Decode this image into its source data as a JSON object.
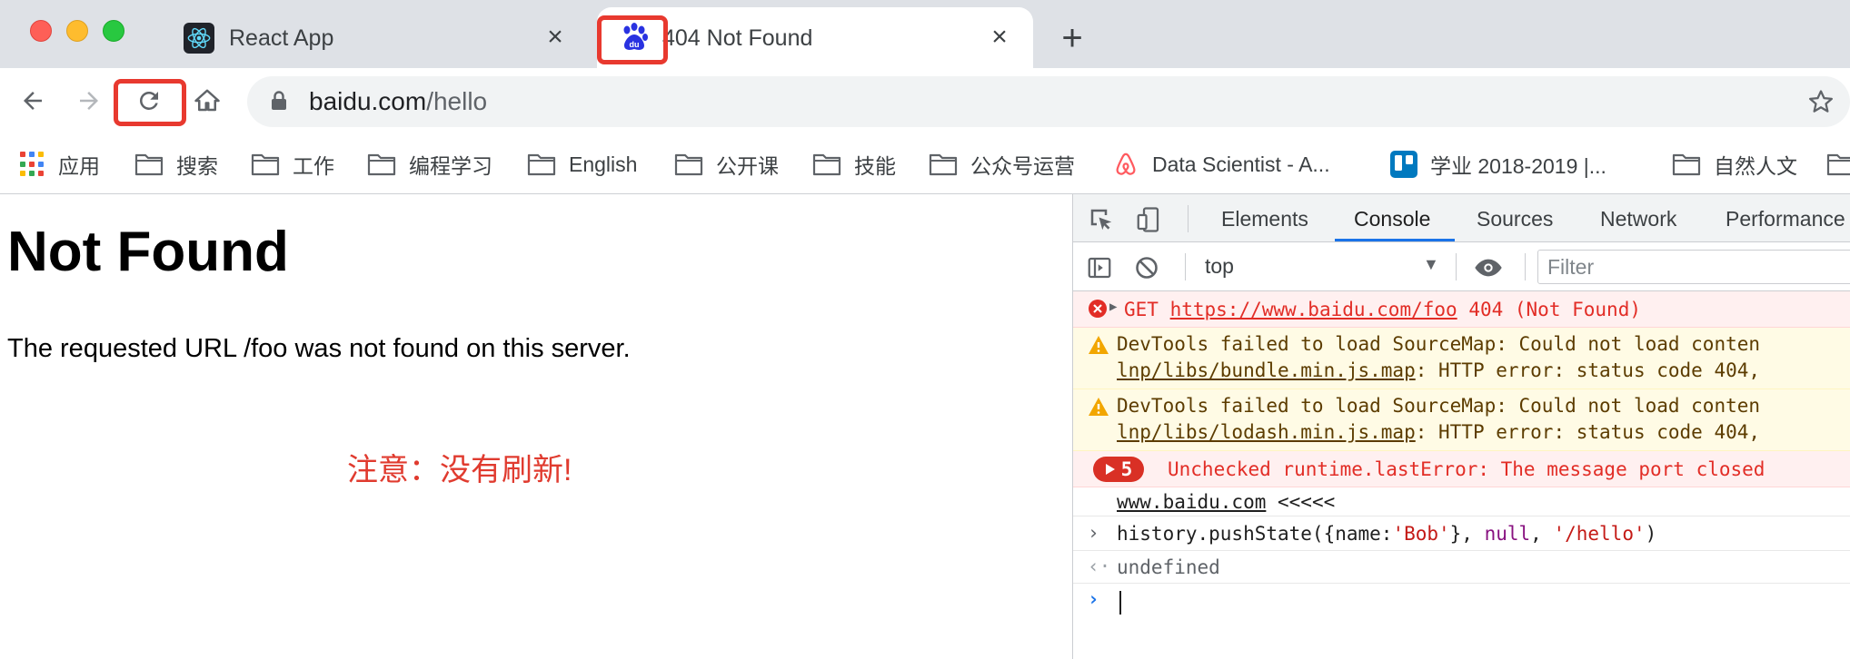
{
  "browser": {
    "tabs": [
      {
        "title": "React App",
        "favicon": "react-icon",
        "active": false
      },
      {
        "title": "404 Not Found",
        "favicon": "baidu-paw-icon",
        "active": true
      }
    ],
    "toolbar": {
      "url_host": "baidu.com",
      "url_path": "/hello"
    },
    "bookmarks": [
      {
        "label": "应用",
        "icon": "apps-grid-icon"
      },
      {
        "label": "搜索",
        "icon": "folder-icon"
      },
      {
        "label": "工作",
        "icon": "folder-icon"
      },
      {
        "label": "编程学习",
        "icon": "folder-icon"
      },
      {
        "label": "English",
        "icon": "folder-icon"
      },
      {
        "label": "公开课",
        "icon": "folder-icon"
      },
      {
        "label": "技能",
        "icon": "folder-icon"
      },
      {
        "label": "公众号运营",
        "icon": "folder-icon"
      },
      {
        "label": "Data Scientist - A...",
        "icon": "airbnb-icon"
      },
      {
        "label": "学业 2018-2019 |...",
        "icon": "trello-icon"
      },
      {
        "label": "自然人文",
        "icon": "folder-icon"
      }
    ],
    "colors": {
      "annotation_red": "#e8392f",
      "tab_strip": "#dee1e6"
    }
  },
  "page": {
    "heading": "Not Found",
    "message": "The requested URL /foo was not found on this server.",
    "annotation": "注意：没有刷新!"
  },
  "devtools": {
    "tabs": [
      "Elements",
      "Console",
      "Sources",
      "Network",
      "Performance"
    ],
    "active_tab": "Console",
    "context": "top",
    "filter_placeholder": "Filter",
    "messages": {
      "error_get": {
        "method": "GET",
        "url": "https://www.baidu.com/foo",
        "status": "404 (Not Found)"
      },
      "warn1": {
        "line1": "DevTools failed to load SourceMap: Could not load conten",
        "link": "lnp/libs/bundle.min.js.map",
        "rest": ": HTTP error: status code 404,"
      },
      "warn2": {
        "line1": "DevTools failed to load SourceMap: Could not load conten",
        "link": "lnp/libs/lodash.min.js.map",
        "rest": ": HTTP error: status code 404,"
      },
      "error_group": {
        "count": "5",
        "text": "Unchecked runtime.lastError: The message port closed"
      },
      "log": {
        "link": "www.baidu.com",
        "text": " <<<<<"
      },
      "command": {
        "p1": "history.pushState({name:",
        "p2": "'Bob'",
        "p3": "}, ",
        "p4": "null",
        "p5": ", ",
        "p6": "'/hello'",
        "p7": ")"
      },
      "result": "undefined"
    }
  }
}
